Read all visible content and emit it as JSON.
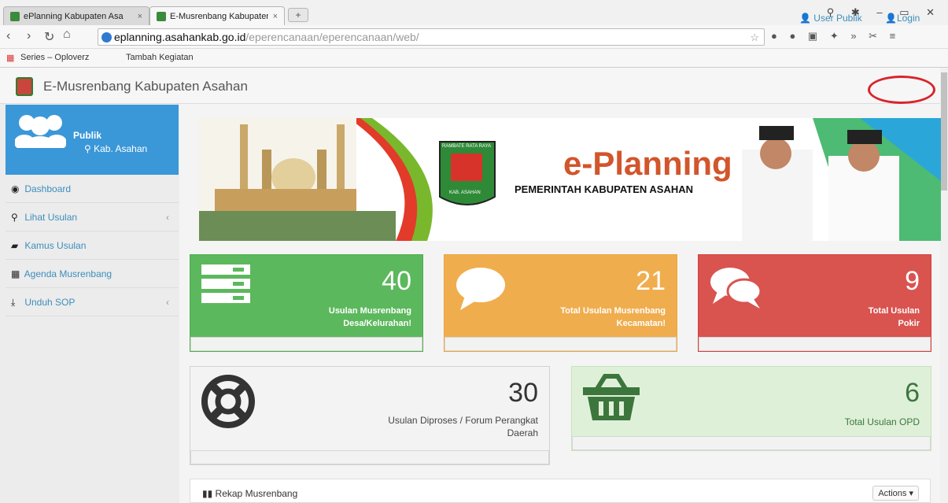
{
  "browser": {
    "tabs": [
      {
        "title": "ePlanning Kabupaten Asa"
      },
      {
        "title": "E-Musrenbang Kabupaten"
      }
    ],
    "new_tab": "+",
    "window_controls": "⚲ ✱ – ▭ ✕",
    "url_host": "eplanning.asahankab.go.id",
    "url_path": "/eperencanaan/eperencanaan/web/",
    "bookmarks": [
      {
        "label": "Series – Oploverz"
      },
      {
        "label": "Tambah Kegiatan"
      }
    ]
  },
  "header": {
    "title": "E-Musrenbang Kabupaten Asahan",
    "user_publik": "User Publik",
    "login": "Login"
  },
  "sidebar": {
    "user_name": "Publik",
    "user_location": "Kab. Asahan",
    "items": [
      {
        "label": "Dashboard",
        "icon": "dashboard-icon"
      },
      {
        "label": "Lihat Usulan",
        "icon": "search-icon"
      },
      {
        "label": "Kamus Usulan",
        "icon": "book-icon"
      },
      {
        "label": "Agenda Musrenbang",
        "icon": "calendar-icon"
      },
      {
        "label": "Unduh SOP",
        "icon": "download-icon"
      }
    ]
  },
  "banner": {
    "title": "e-Planning",
    "subtitle": "PEMERINTAH KABUPATEN ASAHAN",
    "seal_text_top": "RAMBATE RATA RAYA",
    "seal_text_bottom": "KAB. ASAHAN"
  },
  "stats": [
    {
      "value": "40",
      "label_1": "Usulan Musrenbang",
      "label_2": "Desa/Kelurahan!",
      "color": "#5cb85c"
    },
    {
      "value": "21",
      "label_1": "Total Usulan Musrenbang",
      "label_2": "Kecamatan!",
      "color": "#f0ad4e"
    },
    {
      "value": "9",
      "label_1": "Total Usulan",
      "label_2": "Pokir",
      "color": "#d9534f"
    },
    {
      "value": "30",
      "label_1": "Usulan Diproses / Forum Perangkat",
      "label_2": "Daerah"
    },
    {
      "value": "6",
      "label_1": "Total Usulan OPD",
      "label_2": ""
    }
  ],
  "rekap": {
    "title": "Rekap Musrenbang",
    "actions": "Actions ▾"
  }
}
